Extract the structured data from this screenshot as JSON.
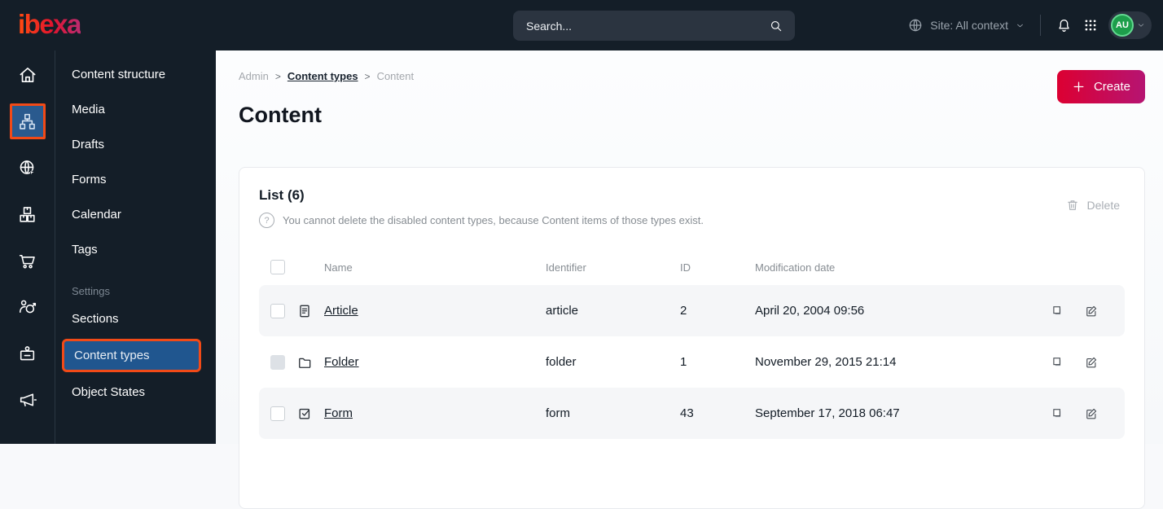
{
  "topbar": {
    "logo_text": "ibexa",
    "search_placeholder": "Search...",
    "site_context_label": "Site: All context",
    "avatar_initials": "AU"
  },
  "icon_sidebar": {
    "items": [
      {
        "name": "home",
        "active": false
      },
      {
        "name": "content-structure",
        "active": true
      },
      {
        "name": "site",
        "active": false
      },
      {
        "name": "products",
        "active": false
      },
      {
        "name": "commerce",
        "active": false
      },
      {
        "name": "personalization",
        "active": false
      },
      {
        "name": "admin",
        "active": false
      },
      {
        "name": "campaigns",
        "active": false
      }
    ]
  },
  "menu_sidebar": {
    "items": [
      "Content structure",
      "Media",
      "Drafts",
      "Forms",
      "Calendar",
      "Tags"
    ],
    "settings_label": "Settings",
    "settings_items": [
      "Sections",
      "Content types",
      "Object States"
    ],
    "active_item": "Content types"
  },
  "breadcrumb": {
    "items": [
      "Admin",
      "Content types",
      "Content"
    ],
    "separator": ">"
  },
  "header_actions": {
    "create_label": "Create"
  },
  "page": {
    "title": "Content"
  },
  "list": {
    "title": "List (6)",
    "help_glyph": "?",
    "info_text": "You cannot delete the disabled content types, because Content items of those types exist.",
    "delete_label": "Delete",
    "columns": {
      "name": "Name",
      "identifier": "Identifier",
      "id": "ID",
      "modified": "Modification date"
    },
    "rows": [
      {
        "icon": "article-icon",
        "name": "Article",
        "identifier": "article",
        "id": "2",
        "modified": "April 20, 2004 09:56",
        "checkbox_disabled": false
      },
      {
        "icon": "folder-icon",
        "name": "Folder",
        "identifier": "folder",
        "id": "1",
        "modified": "November 29, 2015 21:14",
        "checkbox_disabled": true
      },
      {
        "icon": "form-icon",
        "name": "Form",
        "identifier": "form",
        "id": "43",
        "modified": "September 17, 2018 06:47",
        "checkbox_disabled": false
      }
    ]
  },
  "colors": {
    "dark_bg": "#141e28",
    "highlight_border": "#f24a17",
    "active_blue": "#2a5a8e",
    "brand_gradient_start": "#dc0032",
    "brand_gradient_end": "#b61472",
    "avatar_green": "#1d9e4b",
    "row_stripe": "#f5f6f8"
  }
}
